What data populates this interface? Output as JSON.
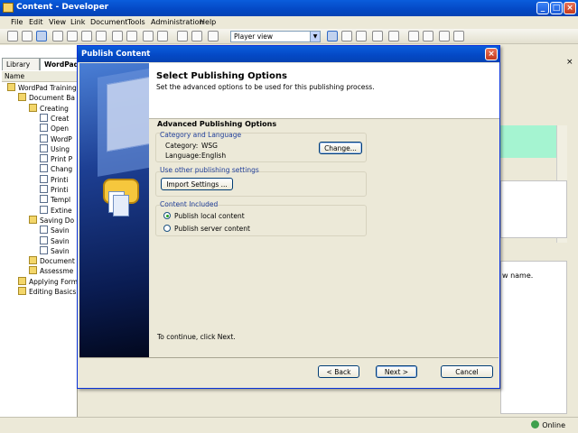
{
  "window": {
    "title": "Content - Developer"
  },
  "menu": [
    "File",
    "Edit",
    "View",
    "Link",
    "Document",
    "Tools",
    "Administration",
    "Help"
  ],
  "toolbar": {
    "view_select": "Player view"
  },
  "left_panel": {
    "tabs": [
      "Library",
      "WordPad"
    ],
    "column_header": "Name",
    "tree": [
      {
        "label": "WordPad Training",
        "indent": 0
      },
      {
        "label": "Document Ba",
        "indent": 1
      },
      {
        "label": "Creating",
        "indent": 2
      },
      {
        "label": "Creat",
        "indent": 3
      },
      {
        "label": "Open",
        "indent": 3
      },
      {
        "label": "WordP",
        "indent": 3
      },
      {
        "label": "Using",
        "indent": 3
      },
      {
        "label": "Print P",
        "indent": 3
      },
      {
        "label": "Chang",
        "indent": 3
      },
      {
        "label": "Printi",
        "indent": 3
      },
      {
        "label": "Printi",
        "indent": 3
      },
      {
        "label": "Templ",
        "indent": 3
      },
      {
        "label": "Extine",
        "indent": 3
      },
      {
        "label": "Saving Do",
        "indent": 2
      },
      {
        "label": "Savin",
        "indent": 3
      },
      {
        "label": "Savin",
        "indent": 3
      },
      {
        "label": "Savin",
        "indent": 3
      },
      {
        "label": "Document",
        "indent": 2
      },
      {
        "label": "Assessme",
        "indent": 2
      },
      {
        "label": "Applying Form",
        "indent": 1
      },
      {
        "label": "Editing Basics",
        "indent": 1
      }
    ]
  },
  "right_panel": {
    "text": "w name."
  },
  "status": {
    "online": "Online"
  },
  "dialog": {
    "title": "Publish Content",
    "heading": "Select Publishing Options",
    "subheading": "Set the advanced options to be used for this publishing process.",
    "section_title": "Advanced Publishing Options",
    "category_group": {
      "label": "Category and Language",
      "category_label": "Category:",
      "category_value": "WSG",
      "language_label": "Language:",
      "language_value": "English",
      "change_button": "Change..."
    },
    "other_settings": {
      "label": "Use other publishing settings",
      "import_button": "Import Settings ..."
    },
    "content_included": {
      "label": "Content Included",
      "options": [
        "Publish local content",
        "Publish server content"
      ],
      "selected": "Publish local content"
    },
    "instruction": "To continue, click Next.",
    "buttons": {
      "back": "< Back",
      "next": "Next >",
      "cancel": "Cancel"
    }
  }
}
